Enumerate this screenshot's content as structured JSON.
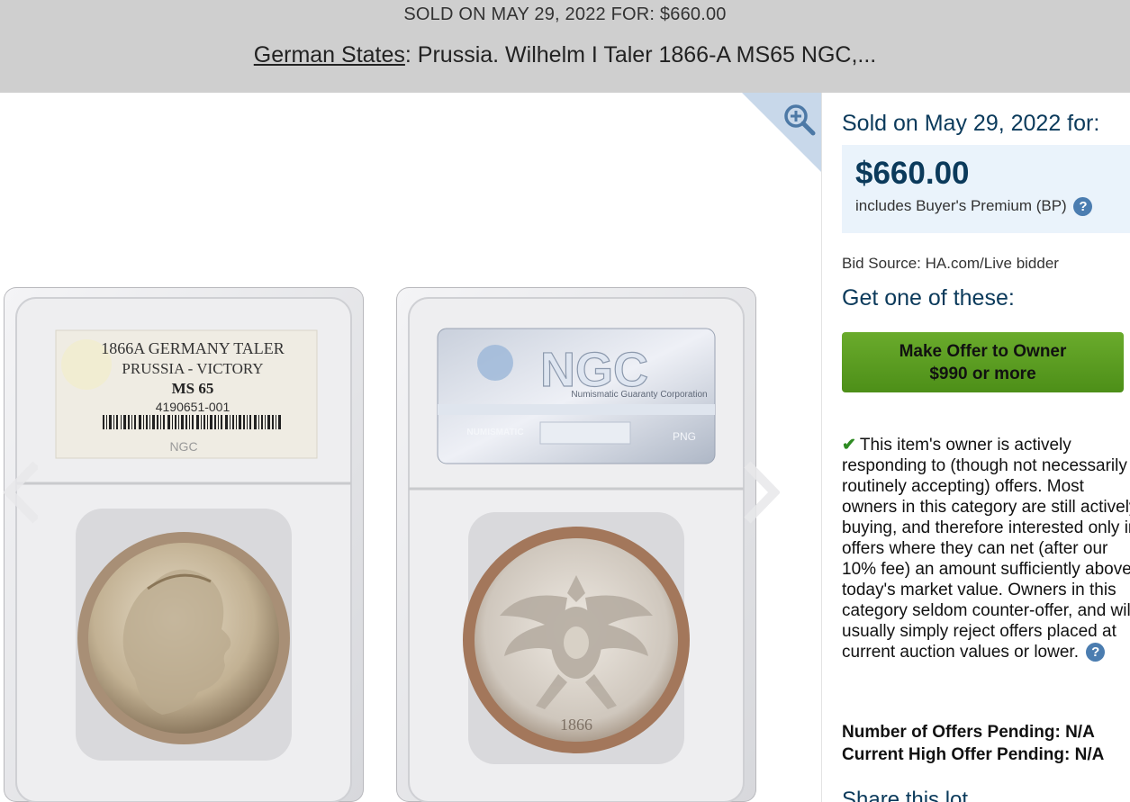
{
  "header": {
    "sold_line": "SOLD ON MAY 29, 2022 FOR: $660.00",
    "category_link": "German States",
    "title_rest": ": Prussia. Wilhelm I Taler 1866-A MS65 NGC,..."
  },
  "viewer": {
    "zoom_icon": "magnify-plus-icon",
    "prev_icon": "chevron-left-icon",
    "next_icon": "chevron-right-icon",
    "left_label": {
      "line1": "1866A GERMANY TALER",
      "line2": "PRUSSIA - VICTORY",
      "grade": "MS 65",
      "cert": "4190651-001",
      "brand": "NGC"
    },
    "right_label": {
      "brand": "NGC",
      "tagline": "Numismatic Guaranty Corporation",
      "ana": "NUMISMATIC",
      "png": "PNG"
    },
    "coin_year": "1866"
  },
  "sidebar": {
    "sold_on": "Sold on May 29, 2022 for:",
    "price": "$660.00",
    "bp_note": "includes Buyer's Premium (BP)",
    "help_icon": "question-circle-icon",
    "bid_source": "Bid Source: HA.com/Live bidder",
    "get_one": "Get one of these:",
    "offer_line1": "Make Offer to Owner",
    "offer_line2": "$990 or more",
    "check_icon": "checkmark-icon",
    "owner_text": "This item's owner is actively responding to (though not necessarily routinely accepting) offers. Most owners in this category are still actively buying, and therefore interested only in offers where they can net (after our 10% fee) an amount sufficiently above today's market value. Owners in this category seldom counter-offer, and will usually simply reject offers placed at current auction values or lower.",
    "offers_pending": "Number of Offers Pending: N/A",
    "high_offer": "Current High Offer Pending: N/A",
    "share": "Share this lot"
  },
  "colors": {
    "header_bg": "#cfcfcf",
    "navy": "#0b3a5b",
    "price_box_bg": "#eaf3fb",
    "offer_green": "#5a9c22"
  }
}
